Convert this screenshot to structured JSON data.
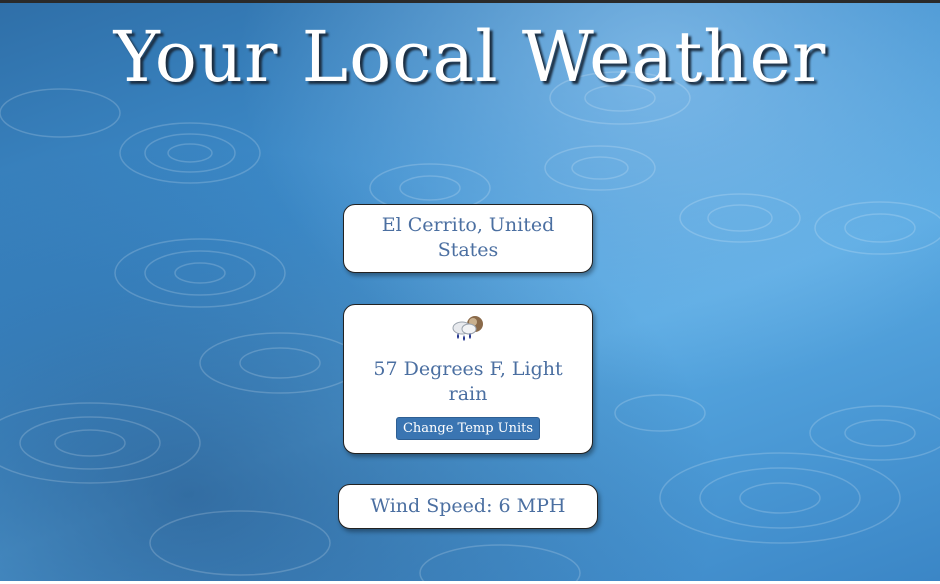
{
  "header": {
    "title": "Your Local Weather"
  },
  "location": {
    "text": "El Cerrito, United States"
  },
  "weather": {
    "icon": "light-rain-cloud-icon",
    "summary": "57 Degrees F, Light rain",
    "toggle_label": "Change Temp Units"
  },
  "wind": {
    "text": "Wind Speed: 6 MPH"
  },
  "colors": {
    "card_text": "#4b6fa1",
    "button_bg": "#3a75b2",
    "title_text": "#ffffff"
  }
}
